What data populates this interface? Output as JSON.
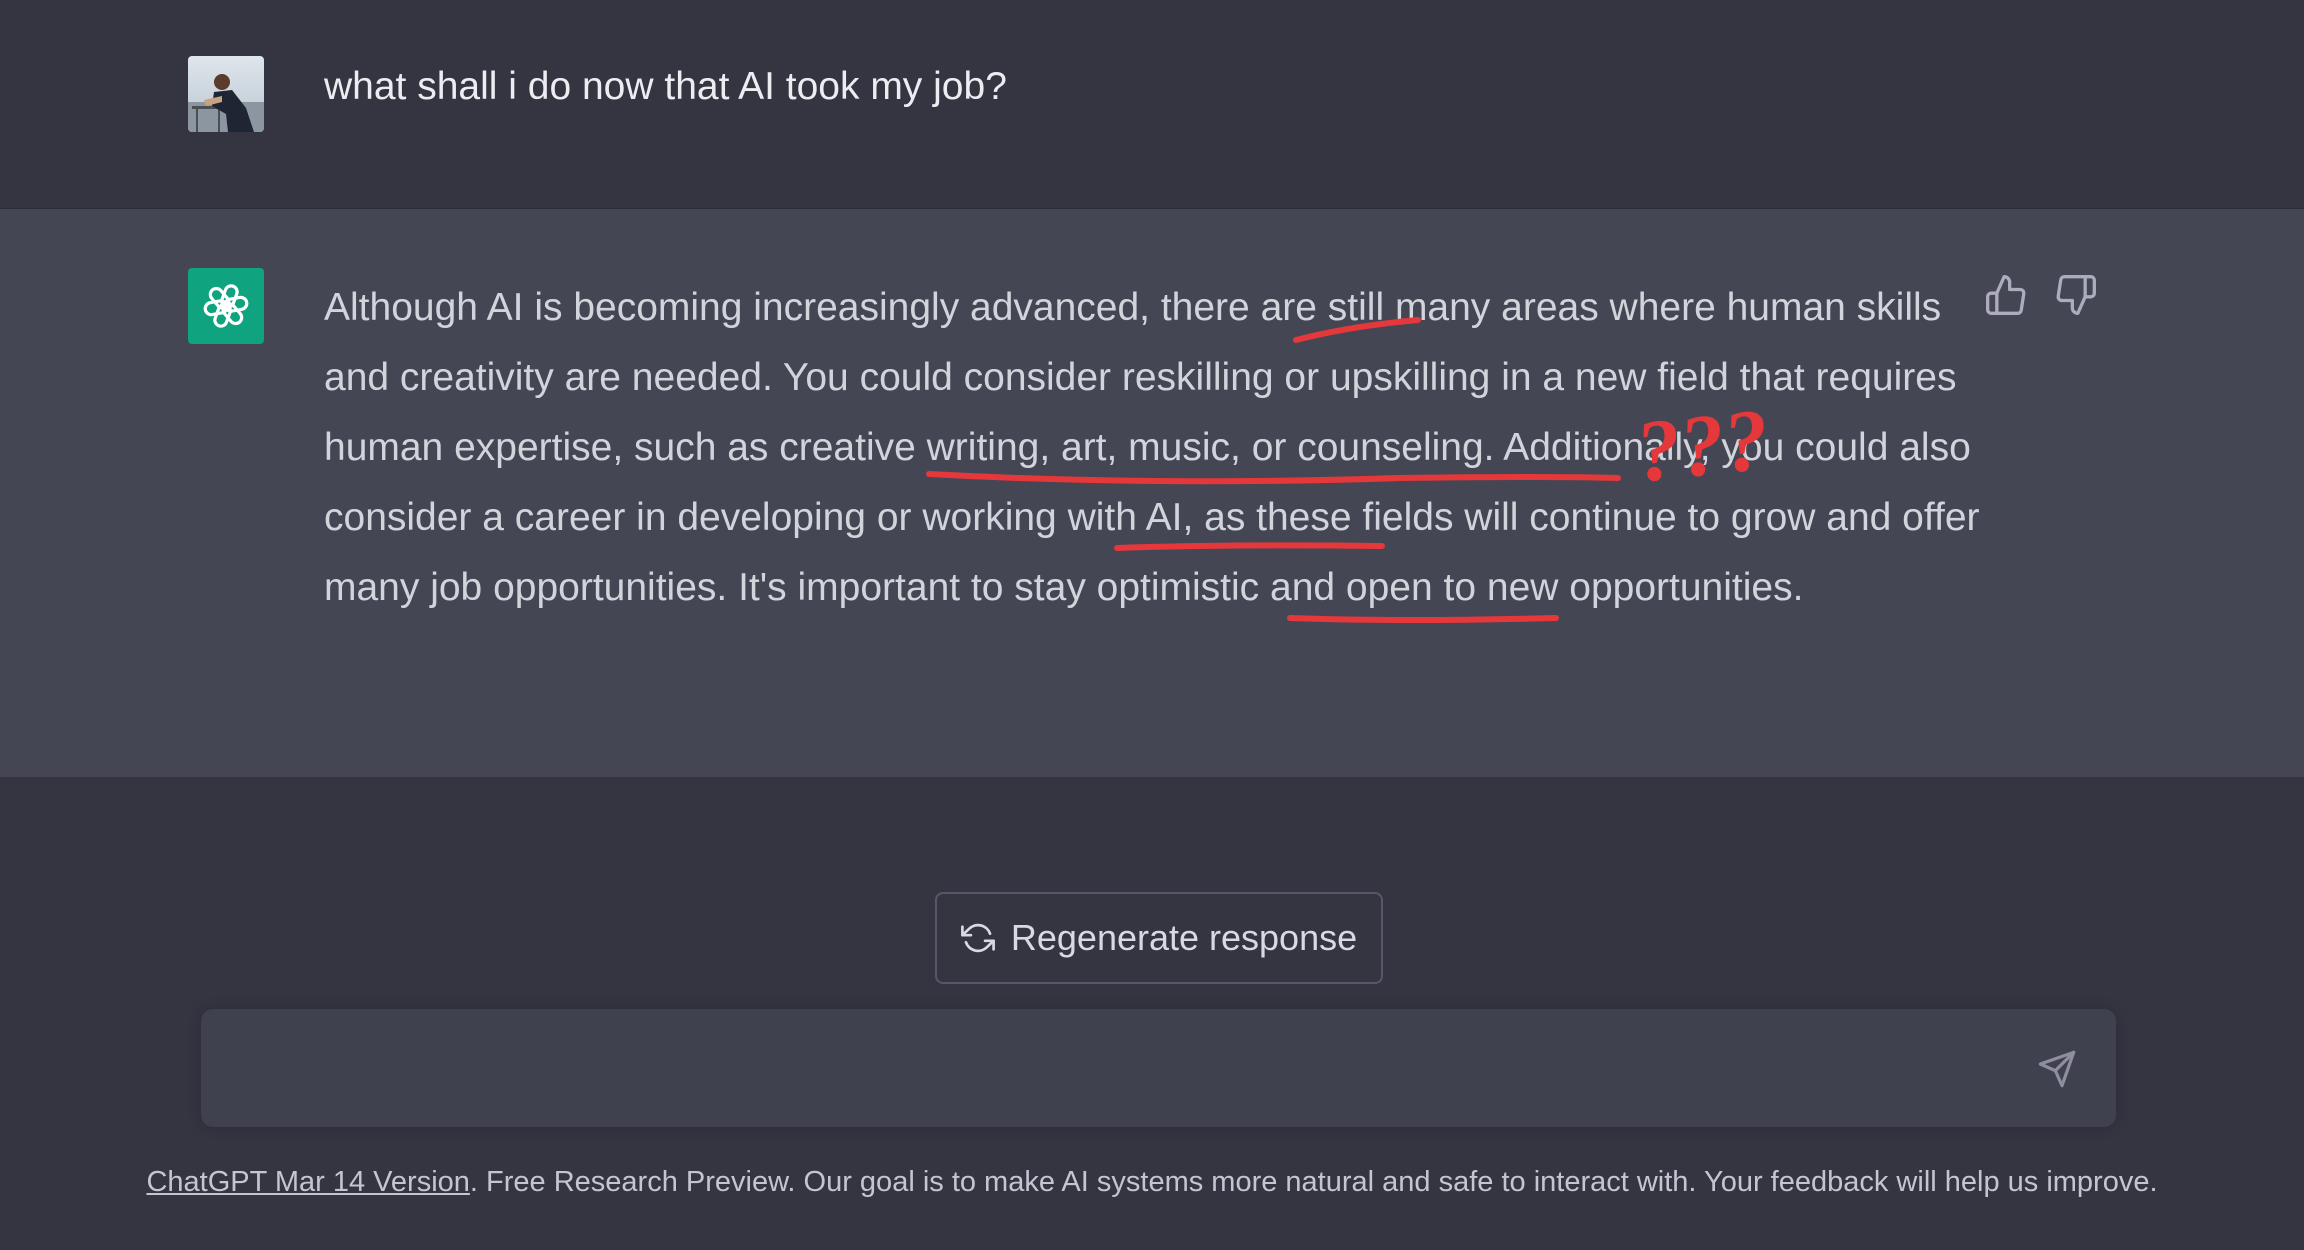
{
  "conversation": {
    "user_message": "what shall i do now that AI took my job?",
    "assistant_message": "Although AI is becoming increasingly advanced, there are still many areas where human skills and creativity are needed. You could consider reskilling or upskilling in a new field that requires human expertise, such as creative writing, art, music, or counseling. Additionally, you could also consider a career in developing or working with AI, as these fields will continue to grow and offer many job opportunities. It's important to stay optimistic and open to new opportunities."
  },
  "annotations": {
    "question_marks": "???",
    "color": "#e5383b"
  },
  "icons": {
    "user_avatar": "user-photo-avatar",
    "assistant_avatar": "openai-logo-icon",
    "thumbs_up": "thumbs-up-icon",
    "thumbs_down": "thumbs-down-icon",
    "regenerate": "refresh-icon",
    "send": "paper-plane-icon"
  },
  "actions": {
    "regenerate_label": "Regenerate response"
  },
  "composer": {
    "placeholder": ""
  },
  "footer": {
    "version_link": "ChatGPT Mar 14 Version",
    "text": ". Free Research Preview. Our goal is to make AI systems more natural and safe to interact with. Your feedback will help us improve."
  },
  "colors": {
    "background": "#343541",
    "assistant_background": "#444654",
    "accent": "#10a37f",
    "input_background": "#40414f"
  }
}
